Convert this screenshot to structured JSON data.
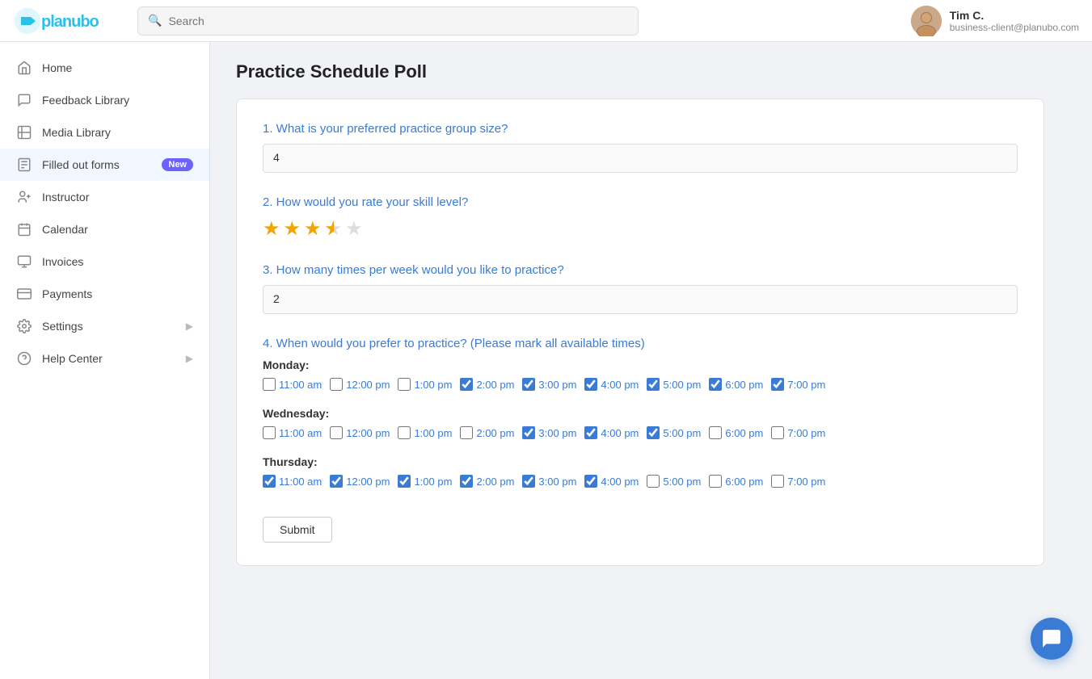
{
  "topnav": {
    "logo": "planubo",
    "search_placeholder": "Search",
    "user": {
      "name": "Tim C.",
      "email": "business-client@planubo.com"
    }
  },
  "sidebar": {
    "items": [
      {
        "id": "home",
        "label": "Home",
        "icon": "home-icon",
        "has_arrow": false
      },
      {
        "id": "feedback-library",
        "label": "Feedback Library",
        "icon": "chat-icon",
        "has_arrow": false
      },
      {
        "id": "media-library",
        "label": "Media Library",
        "icon": "media-icon",
        "has_arrow": false
      },
      {
        "id": "filled-out-forms",
        "label": "Filled out forms",
        "icon": "forms-icon",
        "badge": "New",
        "has_arrow": false
      },
      {
        "id": "instructor",
        "label": "Instructor",
        "icon": "instructor-icon",
        "has_arrow": false
      },
      {
        "id": "calendar",
        "label": "Calendar",
        "icon": "calendar-icon",
        "has_arrow": false
      },
      {
        "id": "invoices",
        "label": "Invoices",
        "icon": "invoices-icon",
        "has_arrow": false
      },
      {
        "id": "payments",
        "label": "Payments",
        "icon": "payments-icon",
        "has_arrow": false
      },
      {
        "id": "settings",
        "label": "Settings",
        "icon": "settings-icon",
        "has_arrow": true
      },
      {
        "id": "help-center",
        "label": "Help Center",
        "icon": "help-icon",
        "has_arrow": true
      }
    ]
  },
  "page": {
    "title": "Practice Schedule Poll"
  },
  "questions": [
    {
      "id": "q1",
      "number": "1",
      "text": "What is your preferred practice group size?",
      "type": "text",
      "answer": "4"
    },
    {
      "id": "q2",
      "number": "2",
      "text": "How would you rate your skill level?",
      "type": "rating",
      "rating": 3.5,
      "max": 5
    },
    {
      "id": "q3",
      "number": "3",
      "text": "How many times per week would you like to practice?",
      "type": "text",
      "answer": "2"
    },
    {
      "id": "q4",
      "number": "4",
      "text": "When would you prefer to practice? (Please mark all available times)",
      "type": "schedule",
      "days": [
        {
          "label": "Monday:",
          "slots": [
            {
              "time": "11:00 am",
              "checked": false
            },
            {
              "time": "12:00 pm",
              "checked": false
            },
            {
              "time": "1:00 pm",
              "checked": false
            },
            {
              "time": "2:00 pm",
              "checked": true
            },
            {
              "time": "3:00 pm",
              "checked": true
            },
            {
              "time": "4:00 pm",
              "checked": true
            },
            {
              "time": "5:00 pm",
              "checked": true
            },
            {
              "time": "6:00 pm",
              "checked": true
            },
            {
              "time": "7:00 pm",
              "checked": true
            }
          ]
        },
        {
          "label": "Wednesday:",
          "slots": [
            {
              "time": "11:00 am",
              "checked": false
            },
            {
              "time": "12:00 pm",
              "checked": false
            },
            {
              "time": "1:00 pm",
              "checked": false
            },
            {
              "time": "2:00 pm",
              "checked": false
            },
            {
              "time": "3:00 pm",
              "checked": true
            },
            {
              "time": "4:00 pm",
              "checked": true
            },
            {
              "time": "5:00 pm",
              "checked": true
            },
            {
              "time": "6:00 pm",
              "checked": false
            },
            {
              "time": "7:00 pm",
              "checked": false
            }
          ]
        },
        {
          "label": "Thursday:",
          "slots": [
            {
              "time": "11:00 am",
              "checked": true
            },
            {
              "time": "12:00 pm",
              "checked": true
            },
            {
              "time": "1:00 pm",
              "checked": true
            },
            {
              "time": "2:00 pm",
              "checked": true
            },
            {
              "time": "3:00 pm",
              "checked": true
            },
            {
              "time": "4:00 pm",
              "checked": true
            },
            {
              "time": "5:00 pm",
              "checked": false
            },
            {
              "time": "6:00 pm",
              "checked": false
            },
            {
              "time": "7:00 pm",
              "checked": false
            }
          ]
        }
      ]
    }
  ],
  "submit_label": "Submit"
}
